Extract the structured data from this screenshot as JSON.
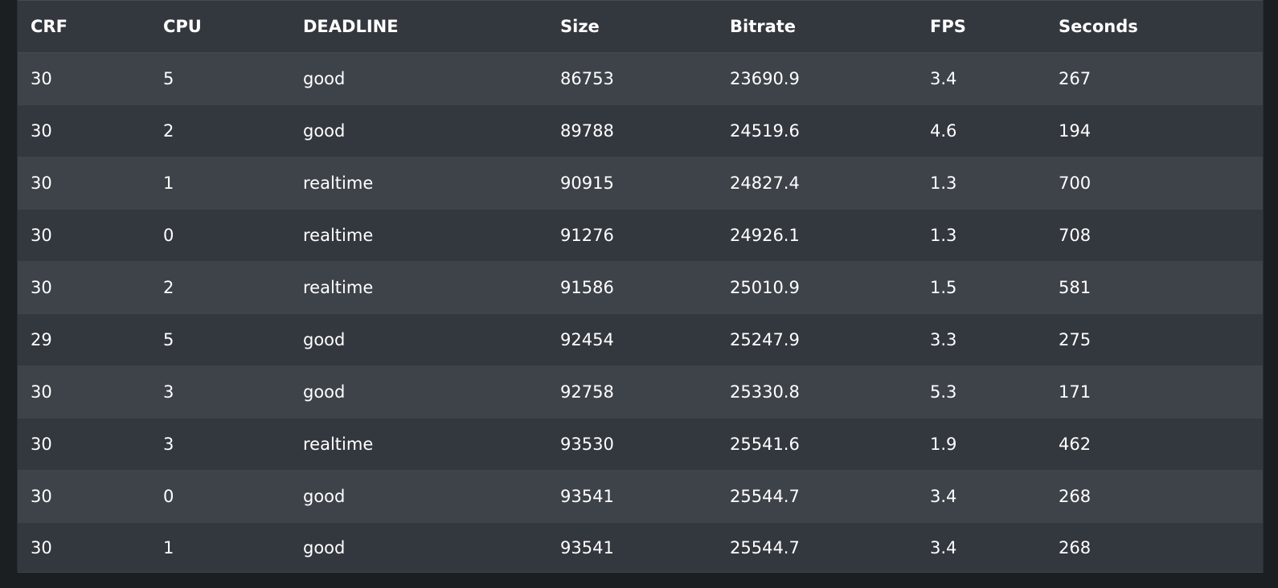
{
  "table": {
    "headers": [
      "CRF",
      "CPU",
      "DEADLINE",
      "Size",
      "Bitrate",
      "FPS",
      "Seconds"
    ],
    "rows": [
      [
        "30",
        "5",
        "good",
        "86753",
        "23690.9",
        "3.4",
        "267"
      ],
      [
        "30",
        "2",
        "good",
        "89788",
        "24519.6",
        "4.6",
        "194"
      ],
      [
        "30",
        "1",
        "realtime",
        "90915",
        "24827.4",
        "1.3",
        "700"
      ],
      [
        "30",
        "0",
        "realtime",
        "91276",
        "24926.1",
        "1.3",
        "708"
      ],
      [
        "30",
        "2",
        "realtime",
        "91586",
        "25010.9",
        "1.5",
        "581"
      ],
      [
        "29",
        "5",
        "good",
        "92454",
        "25247.9",
        "3.3",
        "275"
      ],
      [
        "30",
        "3",
        "good",
        "92758",
        "25330.8",
        "5.3",
        "171"
      ],
      [
        "30",
        "3",
        "realtime",
        "93530",
        "25541.6",
        "1.9",
        "462"
      ],
      [
        "30",
        "0",
        "good",
        "93541",
        "25544.7",
        "3.4",
        "268"
      ],
      [
        "30",
        "1",
        "good",
        "93541",
        "25544.7",
        "3.4",
        "268"
      ]
    ]
  },
  "colors": {
    "page_background": "#1b1f22",
    "row_odd": "#3e434a",
    "row_even": "#33373e",
    "text": "#ffffff"
  }
}
